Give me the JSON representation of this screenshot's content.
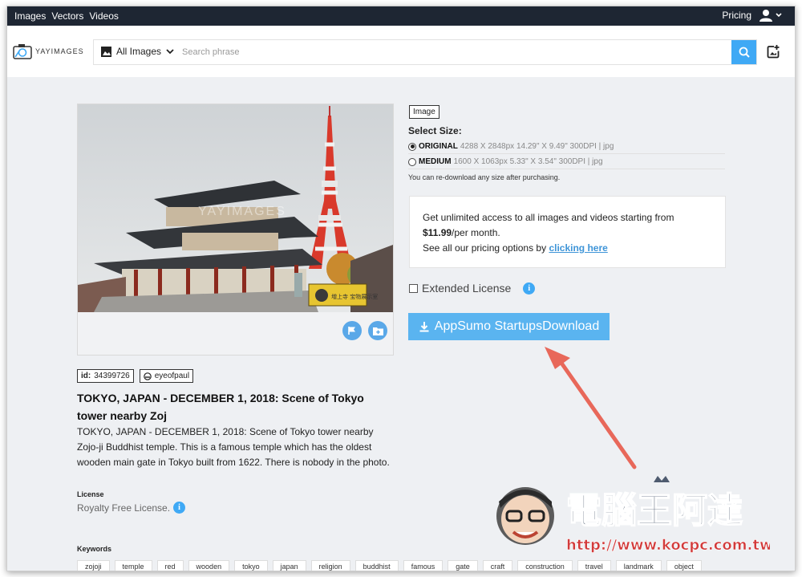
{
  "topbar": {
    "nav": [
      "Images",
      "Vectors",
      "Videos"
    ],
    "pricing": "Pricing"
  },
  "logo": {
    "text": "YAYIMAGES"
  },
  "search": {
    "category": "All Images",
    "placeholder": "Search phrase"
  },
  "image": {
    "type": "Image",
    "watermark": "YAYIMAGES",
    "id_label": "id:",
    "id_value": "34399726",
    "author": "eyeofpaul",
    "sign_text": "増上寺 宝物展示室"
  },
  "title": "TOKYO, JAPAN - DECEMBER 1, 2018: Scene of Tokyo tower nearby Zoj",
  "description": "TOKYO, JAPAN - DECEMBER 1, 2018: Scene of Tokyo tower nearby Zojo-ji Buddhist temple. This is a famous temple which has the oldest wooden main gate in Tokyo built from 1622. There is nobody in the photo.",
  "license": {
    "label": "License",
    "value": "Royalty Free License."
  },
  "keywords": {
    "label": "Keywords",
    "items": [
      "zojoji",
      "temple",
      "red",
      "wooden",
      "tokyo",
      "japan",
      "religion",
      "buddhist",
      "famous",
      "gate",
      "craft",
      "construction",
      "travel",
      "landmark",
      "object"
    ]
  },
  "sizes": {
    "heading": "Select Size:",
    "options": [
      {
        "name": "ORIGINAL",
        "spec": "4288 X 2848px 14.29\" X 9.49\" 300DPI | jpg",
        "selected": true
      },
      {
        "name": "MEDIUM",
        "spec": "1600 X 1063px 5.33\" X 3.54\" 300DPI | jpg",
        "selected": false
      }
    ],
    "note": "You can re-download any size after purchasing."
  },
  "promo": {
    "line1": "Get unlimited access to all images and videos starting from",
    "price": "$11.99",
    "per": "/per month.",
    "line3": "See all our pricing options by",
    "link": "clicking here"
  },
  "extended": {
    "label": "Extended License",
    "checked": false
  },
  "download": {
    "label": "AppSumo StartupsDownload"
  },
  "watermark_site": {
    "name": "電腦王阿達",
    "url": "http://www.kocpc.com.tw"
  },
  "colors": {
    "accent": "#3fa9f5",
    "topbar": "#1e2633",
    "arrow": "#e8685a",
    "button": "#5ab4f0"
  }
}
